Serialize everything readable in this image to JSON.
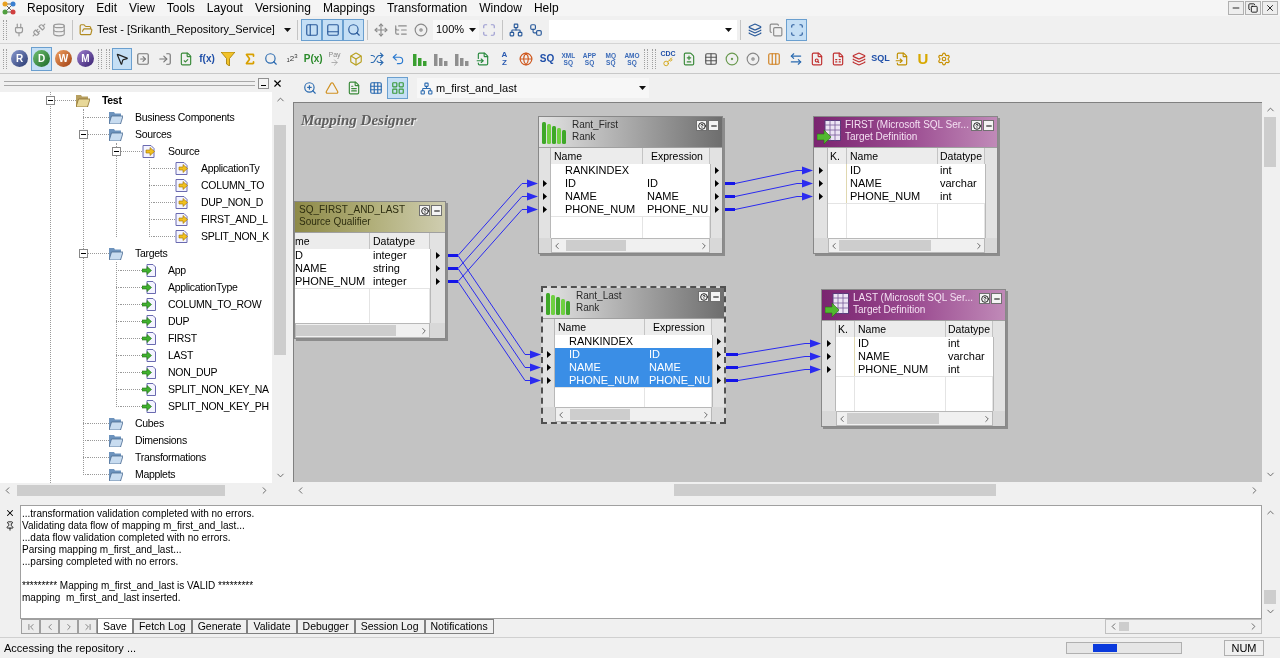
{
  "menu_bar": {
    "items": [
      "Repository",
      "Edit",
      "View",
      "Tools",
      "Layout",
      "Versioning",
      "Mappings",
      "Transformation",
      "Window",
      "Help"
    ]
  },
  "toolbar_1": {
    "folder_dropdown": {
      "value": "Test - [Srikanth_Repository_Service]"
    },
    "view_toggles": [
      {
        "selected": true
      },
      {
        "selected": true
      },
      {
        "selected": true
      }
    ],
    "zoom_dropdown": {
      "value": "100%"
    },
    "arrange_toggles": [
      {
        "selected": false
      },
      {
        "selected": false
      },
      {
        "selected": true
      }
    ]
  },
  "toolbar_2": {
    "tool_buttons": [
      {
        "label": "R",
        "selected": false
      },
      {
        "label": "D",
        "selected": true
      },
      {
        "label": "W",
        "selected": false
      },
      {
        "label": "M",
        "selected": false
      }
    ],
    "transformation_tools": [
      {
        "selected": true
      },
      {
        "selected": false
      },
      {
        "selected": false
      },
      {
        "selected": false
      },
      {
        "label": "f(x)",
        "selected": false
      },
      {
        "selected": false
      },
      {
        "selected": false
      },
      {
        "selected": false
      },
      {
        "label": "$_{1}$2$^{3}$",
        "selected": false
      },
      {
        "label": "P(x)",
        "selected": false
      },
      {
        "label": "Pay",
        "selected": false
      },
      {
        "selected": false
      },
      {
        "selected": false
      },
      {
        "selected": false
      },
      {
        "selected": false
      },
      {
        "selected": false
      },
      {
        "selected": false
      },
      {
        "selected": false
      },
      {
        "label": "AZ",
        "selected": false
      },
      {
        "selected": false
      },
      {
        "label": "SQ",
        "selected": false
      },
      {
        "label": "XML SQ",
        "selected": false
      },
      {
        "label": "APP SQ",
        "selected": false
      },
      {
        "label": "MQ SQ",
        "selected": false
      },
      {
        "label": "AMO SQ",
        "selected": false
      }
    ],
    "more_tools": [
      {
        "label": "CDC",
        "selected": false
      },
      {
        "selected": false
      },
      {
        "selected": false
      },
      {
        "selected": false
      },
      {
        "selected": false
      },
      {
        "selected": false
      },
      {
        "selected": false
      },
      {
        "selected": false
      },
      {
        "selected": false
      },
      {
        "selected": false
      },
      {
        "label": "SQL",
        "selected": false
      },
      {
        "selected": false
      },
      {
        "label": "U",
        "selected": false
      },
      {
        "selected": false
      }
    ]
  },
  "navigator": {
    "tree": [
      {
        "label": "Test",
        "kind": "repository_folder",
        "expanded": true,
        "children": [
          {
            "label": "Business Components",
            "kind": "folder"
          },
          {
            "label": "Sources",
            "kind": "folder",
            "expanded": true,
            "children": [
              {
                "label": "Source",
                "kind": "source",
                "expanded": true,
                "children": [
                  {
                    "label": "ApplicationTy",
                    "kind": "source"
                  },
                  {
                    "label": "COLUMN_TO",
                    "kind": "source"
                  },
                  {
                    "label": "DUP_NON_D",
                    "kind": "source"
                  },
                  {
                    "label": "FIRST_AND_L",
                    "kind": "source"
                  },
                  {
                    "label": "SPLIT_NON_K",
                    "kind": "source"
                  }
                ]
              }
            ]
          },
          {
            "label": "Targets",
            "kind": "folder",
            "expanded": true,
            "children": [
              {
                "label": "App",
                "kind": "target"
              },
              {
                "label": "ApplicationType",
                "kind": "target"
              },
              {
                "label": "COLUMN_TO_ROW",
                "kind": "target"
              },
              {
                "label": "DUP",
                "kind": "target"
              },
              {
                "label": "FIRST",
                "kind": "target"
              },
              {
                "label": "LAST",
                "kind": "target"
              },
              {
                "label": "NON_DUP",
                "kind": "target"
              },
              {
                "label": "SPLIT_NON_KEY_NA",
                "kind": "target"
              },
              {
                "label": "SPLIT_NON_KEY_PH",
                "kind": "target"
              }
            ]
          },
          {
            "label": "Cubes",
            "kind": "folder"
          },
          {
            "label": "Dimensions",
            "kind": "folder"
          },
          {
            "label": "Transformations",
            "kind": "folder"
          },
          {
            "label": "Mapplets",
            "kind": "folder"
          }
        ]
      }
    ]
  },
  "canvas_toolbar": {
    "tools": [
      {
        "selected": false
      },
      {
        "selected": false
      },
      {
        "selected": false
      },
      {
        "selected": false
      },
      {
        "selected": true
      }
    ],
    "mapping_dropdown": {
      "value": "m_first_and_last"
    }
  },
  "canvas": {
    "title": "Mapping Designer",
    "transformations": [
      {
        "kind": "rank",
        "name": "Rant_First",
        "type": "Rank",
        "selected": false,
        "columns": [
          "Name",
          "Expression"
        ],
        "rows": [
          {
            "cells": [
              "RANKINDEX"
            ],
            "input": false,
            "output": true,
            "selected": false
          },
          {
            "cells": [
              "ID",
              "ID"
            ],
            "input": true,
            "output": true,
            "selected": false
          },
          {
            "cells": [
              "NAME",
              "NAME"
            ],
            "input": true,
            "output": true,
            "selected": false
          },
          {
            "cells": [
              "PHONE_NUM",
              "PHONE_NU"
            ],
            "input": true,
            "output": true,
            "selected": false
          }
        ]
      },
      {
        "kind": "target",
        "name": "FIRST (Microsoft SQL Ser...",
        "type": "Target Definition",
        "selected": false,
        "columns": [
          "K.",
          "Name",
          "Datatype"
        ],
        "rows": [
          {
            "cells": [
              "",
              "ID",
              "int"
            ],
            "input": true,
            "output": false,
            "selected": false
          },
          {
            "cells": [
              "",
              "NAME",
              "varchar"
            ],
            "input": true,
            "output": false,
            "selected": false
          },
          {
            "cells": [
              "",
              "PHONE_NUM",
              "int"
            ],
            "input": true,
            "output": false,
            "selected": false
          }
        ]
      },
      {
        "kind": "source_qualifier",
        "name": "SQ_FIRST_AND_LAST",
        "type": "Source Qualifier",
        "selected": false,
        "columns": [
          "me",
          "Datatype"
        ],
        "rows": [
          {
            "cells": [
              "D",
              "integer"
            ],
            "output": true,
            "selected": false
          },
          {
            "cells": [
              "NAME",
              "string"
            ],
            "output": true,
            "selected": false
          },
          {
            "cells": [
              "PHONE_NUM",
              "integer"
            ],
            "output": true,
            "selected": false
          }
        ]
      },
      {
        "kind": "rank",
        "name": "Rant_Last",
        "type": "Rank",
        "selected": true,
        "columns": [
          "Name",
          "Expression"
        ],
        "rows": [
          {
            "cells": [
              "RANKINDEX"
            ],
            "input": false,
            "output": true,
            "selected": false
          },
          {
            "cells": [
              "ID",
              "ID"
            ],
            "input": true,
            "output": true,
            "selected": true
          },
          {
            "cells": [
              "NAME",
              "NAME"
            ],
            "input": true,
            "output": true,
            "selected": true
          },
          {
            "cells": [
              "PHONE_NUM",
              "PHONE_NU"
            ],
            "input": true,
            "output": true,
            "selected": true
          }
        ]
      },
      {
        "kind": "target",
        "name": "LAST (Microsoft SQL Ser...",
        "type": "Target Definition",
        "selected": false,
        "columns": [
          "K.",
          "Name",
          "Datatype"
        ],
        "rows": [
          {
            "cells": [
              "",
              "ID",
              "int"
            ],
            "input": true,
            "output": false,
            "selected": false
          },
          {
            "cells": [
              "",
              "NAME",
              "varchar"
            ],
            "input": true,
            "output": false,
            "selected": false
          },
          {
            "cells": [
              "",
              "PHONE_NUM",
              "int"
            ],
            "input": true,
            "output": false,
            "selected": false
          }
        ]
      }
    ]
  },
  "output": {
    "blocks": [
      [
        "...transformation validation completed with no errors.",
        "Validating data flow of mapping m_first_and_last...",
        "...data flow validation completed with no errors.",
        "Parsing mapping m_first_and_last...",
        "...parsing completed with no errors."
      ],
      [
        "********* Mapping m_first_and_last is VALID *********",
        "mapping  m_first_and_last inserted."
      ]
    ],
    "tabs": [
      {
        "label": "Save",
        "selected": true
      },
      {
        "label": "Fetch Log",
        "selected": false
      },
      {
        "label": "Generate",
        "selected": false
      },
      {
        "label": "Validate",
        "selected": false
      },
      {
        "label": "Debugger",
        "selected": false
      },
      {
        "label": "Session Log",
        "selected": false
      },
      {
        "label": "Notifications",
        "selected": false
      }
    ]
  },
  "status_bar": {
    "message": "Accessing the repository ...",
    "indicator": "NUM"
  }
}
